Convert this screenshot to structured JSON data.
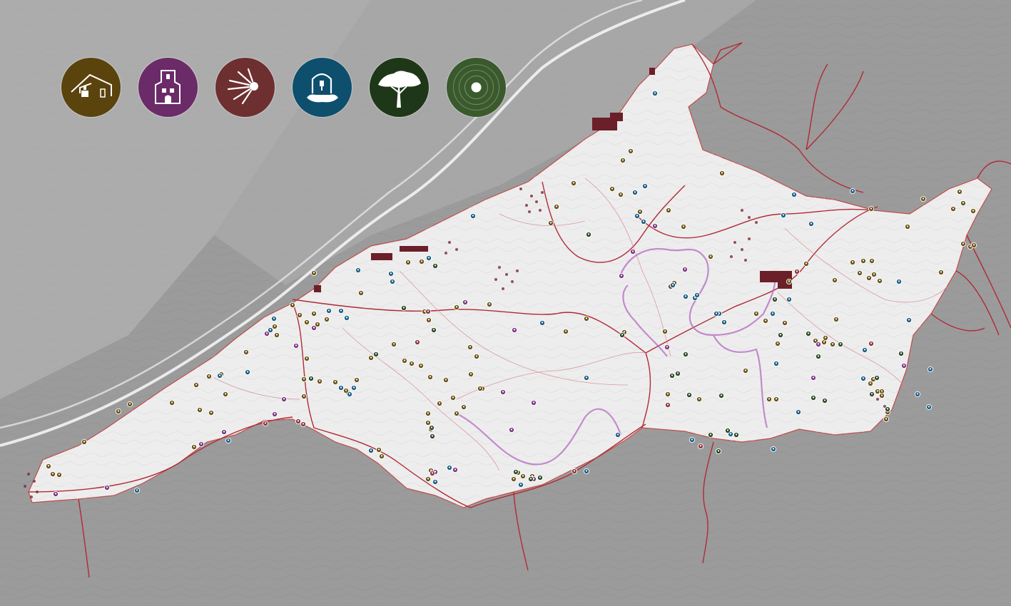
{
  "map": {
    "background": "#9b9b9b",
    "study_area_fill": "#ededed",
    "route_color": "#b02a37",
    "trail_color": "#b46ac2"
  },
  "legend": {
    "items": [
      {
        "icon": "masia-farmhouse-icon",
        "color": "#5a430d"
      },
      {
        "icon": "church-icon",
        "color": "#6a2b68"
      },
      {
        "icon": "viewpoint-icon",
        "color": "#6e2f31"
      },
      {
        "icon": "fountain-icon",
        "color": "#0d4f6d"
      },
      {
        "icon": "tree-icon",
        "color": "#1f3719"
      },
      {
        "icon": "point-of-interest-icon",
        "color": "#3a5a2e"
      }
    ]
  },
  "points": {
    "farmhouse": [
      [
        182,
        567
      ],
      [
        166,
        577
      ],
      [
        241,
        565
      ],
      [
        275,
        540
      ],
      [
        293,
        528
      ],
      [
        310,
        525
      ],
      [
        316,
        553
      ],
      [
        280,
        575
      ],
      [
        296,
        579
      ],
      [
        272,
        627
      ],
      [
        118,
        620
      ],
      [
        68,
        654
      ],
      [
        83,
        666
      ],
      [
        74,
        665
      ],
      [
        345,
        494
      ],
      [
        410,
        428
      ],
      [
        420,
        442
      ],
      [
        430,
        452
      ],
      [
        440,
        440
      ],
      [
        445,
        455
      ],
      [
        458,
        448
      ],
      [
        385,
        458
      ],
      [
        388,
        470
      ],
      [
        430,
        503
      ],
      [
        426,
        532
      ],
      [
        426,
        556
      ],
      [
        448,
        535
      ],
      [
        470,
        536
      ],
      [
        487,
        550
      ],
      [
        500,
        533
      ],
      [
        485,
        548
      ],
      [
        552,
        483
      ],
      [
        577,
        510
      ],
      [
        567,
        506
      ],
      [
        590,
        513
      ],
      [
        520,
        502
      ],
      [
        603,
        529
      ],
      [
        616,
        566
      ],
      [
        625,
        533
      ],
      [
        635,
        558
      ],
      [
        640,
        580
      ],
      [
        600,
        580
      ],
      [
        600,
        593
      ],
      [
        604,
        602
      ],
      [
        659,
        487
      ],
      [
        668,
        500
      ],
      [
        660,
        525
      ],
      [
        676,
        545
      ],
      [
        595,
        437
      ],
      [
        601,
        449
      ],
      [
        640,
        431
      ],
      [
        686,
        427
      ],
      [
        673,
        545
      ],
      [
        650,
        571
      ],
      [
        604,
        660
      ],
      [
        600,
        672
      ],
      [
        531,
        631
      ],
      [
        535,
        640
      ],
      [
        506,
        411
      ],
      [
        440,
        383
      ],
      [
        572,
        368
      ],
      [
        591,
        367
      ],
      [
        726,
        663
      ],
      [
        733,
        668
      ],
      [
        746,
        668
      ],
      [
        720,
        672
      ],
      [
        793,
        465
      ],
      [
        822,
        447
      ],
      [
        870,
        273
      ],
      [
        884,
        212
      ],
      [
        804,
        257
      ],
      [
        780,
        290
      ],
      [
        772,
        313
      ],
      [
        858,
        265
      ],
      [
        873,
        225
      ],
      [
        897,
        297
      ],
      [
        937,
        295
      ],
      [
        958,
        318
      ],
      [
        1012,
        243
      ],
      [
        996,
        360
      ],
      [
        1106,
        395
      ],
      [
        1130,
        370
      ],
      [
        1170,
        393
      ],
      [
        1195,
        368
      ],
      [
        1205,
        383
      ],
      [
        1210,
        366
      ],
      [
        1218,
        390
      ],
      [
        1225,
        385
      ],
      [
        1233,
        394
      ],
      [
        1222,
        366
      ],
      [
        1221,
        293
      ],
      [
        1272,
        318
      ],
      [
        1294,
        279
      ],
      [
        1319,
        382
      ],
      [
        1336,
        293
      ],
      [
        1345,
        269
      ],
      [
        1364,
        296
      ],
      [
        1350,
        342
      ],
      [
        1360,
        346
      ],
      [
        1365,
        344
      ],
      [
        1060,
        440
      ],
      [
        1073,
        450
      ],
      [
        1090,
        482
      ],
      [
        1100,
        453
      ],
      [
        1045,
        520
      ],
      [
        1078,
        560
      ],
      [
        1088,
        560
      ],
      [
        1143,
        478
      ],
      [
        1155,
        480
      ],
      [
        1157,
        474
      ],
      [
        1167,
        483
      ],
      [
        1172,
        448
      ],
      [
        1224,
        532
      ],
      [
        1230,
        549
      ],
      [
        1236,
        549
      ],
      [
        1244,
        578
      ],
      [
        1220,
        538
      ],
      [
        1242,
        588
      ],
      [
        945,
        397
      ],
      [
        940,
        402
      ],
      [
        980,
        560
      ],
      [
        875,
        466
      ],
      [
        936,
        553
      ],
      [
        932,
        465
      ],
      [
        1236,
        555
      ],
      [
        1350,
        285
      ]
    ],
    "church": [
      [
        150,
        684
      ],
      [
        78,
        693
      ],
      [
        282,
        623
      ],
      [
        314,
        606
      ],
      [
        385,
        581
      ],
      [
        398,
        560
      ],
      [
        374,
        468
      ],
      [
        415,
        485
      ],
      [
        440,
        460
      ],
      [
        721,
        463
      ],
      [
        717,
        603
      ],
      [
        705,
        550
      ],
      [
        748,
        565
      ],
      [
        748,
        672
      ],
      [
        610,
        662
      ],
      [
        638,
        659
      ],
      [
        652,
        424
      ],
      [
        887,
        353
      ],
      [
        871,
        387
      ],
      [
        960,
        378
      ],
      [
        935,
        487
      ],
      [
        1267,
        513
      ],
      [
        1140,
        530
      ],
      [
        1147,
        483
      ],
      [
        918,
        317
      ]
    ],
    "viewpoint": [
      [
        372,
        594
      ],
      [
        418,
        591
      ],
      [
        425,
        595
      ],
      [
        805,
        661
      ],
      [
        606,
        664
      ],
      [
        936,
        568
      ],
      [
        982,
        626
      ],
      [
        1221,
        482
      ],
      [
        1117,
        381
      ],
      [
        585,
        480
      ],
      [
        600,
        437
      ]
    ],
    "fountain": [
      [
        192,
        688
      ],
      [
        320,
        618
      ],
      [
        308,
        527
      ],
      [
        347,
        522
      ],
      [
        379,
        463
      ],
      [
        384,
        447
      ],
      [
        461,
        436
      ],
      [
        478,
        436
      ],
      [
        486,
        446
      ],
      [
        478,
        544
      ],
      [
        490,
        553
      ],
      [
        496,
        544
      ],
      [
        502,
        379
      ],
      [
        548,
        384
      ],
      [
        550,
        395
      ],
      [
        601,
        362
      ],
      [
        663,
        303
      ],
      [
        760,
        453
      ],
      [
        822,
        530
      ],
      [
        822,
        661
      ],
      [
        866,
        610
      ],
      [
        890,
        270
      ],
      [
        918,
        131
      ],
      [
        904,
        261
      ],
      [
        893,
        303
      ],
      [
        902,
        311
      ],
      [
        943,
        400
      ],
      [
        974,
        418
      ],
      [
        1015,
        452
      ],
      [
        1008,
        440
      ],
      [
        1004,
        440
      ],
      [
        1086,
        420
      ],
      [
        1083,
        440
      ],
      [
        1088,
        510
      ],
      [
        1113,
        273
      ],
      [
        1098,
        302
      ],
      [
        1137,
        314
      ],
      [
        1195,
        268
      ],
      [
        1106,
        420
      ],
      [
        1260,
        395
      ],
      [
        1274,
        449
      ],
      [
        1212,
        491
      ],
      [
        1210,
        531
      ],
      [
        1286,
        553
      ],
      [
        1304,
        518
      ],
      [
        1302,
        571
      ],
      [
        1119,
        578
      ],
      [
        1024,
        609
      ],
      [
        970,
        617
      ],
      [
        1084,
        630
      ],
      [
        520,
        632
      ],
      [
        630,
        656
      ],
      [
        610,
        676
      ],
      [
        730,
        680
      ],
      [
        977,
        414
      ],
      [
        961,
        416
      ]
    ],
    "tree": [
      [
        527,
        497
      ],
      [
        610,
        373
      ],
      [
        566,
        432
      ],
      [
        608,
        463
      ],
      [
        436,
        531
      ],
      [
        825,
        329
      ],
      [
        723,
        662
      ],
      [
        744,
        672
      ],
      [
        757,
        670
      ],
      [
        872,
        470
      ],
      [
        966,
        554
      ],
      [
        1011,
        555
      ],
      [
        1020,
        604
      ],
      [
        996,
        610
      ],
      [
        1007,
        633
      ],
      [
        1032,
        610
      ],
      [
        942,
        527
      ],
      [
        950,
        524
      ],
      [
        1133,
        468
      ],
      [
        1147,
        500
      ],
      [
        1263,
        496
      ],
      [
        1229,
        530
      ],
      [
        1222,
        553
      ],
      [
        1244,
        574
      ],
      [
        1094,
        470
      ],
      [
        1178,
        483
      ],
      [
        961,
        497
      ],
      [
        1156,
        562
      ],
      [
        1140,
        558
      ],
      [
        1086,
        420
      ],
      [
        605,
        600
      ],
      [
        606,
        612
      ]
    ]
  }
}
